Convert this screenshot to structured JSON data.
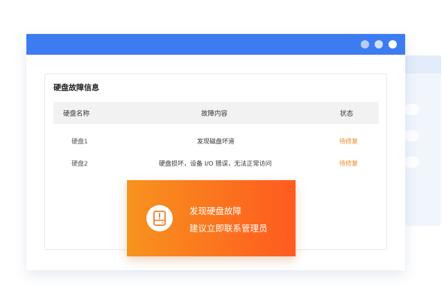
{
  "panel": {
    "title": "硬盘故障信息",
    "columns": [
      "硬盘名称",
      "故障内容",
      "状态"
    ],
    "rows": [
      {
        "name": "硬盘1",
        "content": "发现磁盘坏道",
        "status": "待修复"
      },
      {
        "name": "硬盘2",
        "content": "硬盘损坏，设备 I/O 错误，无法正常访问",
        "status": "待修复"
      }
    ]
  },
  "alert": {
    "line1": "发现硬盘故障",
    "line2": "建议立即联系管理员",
    "icon": "hard-disk-warning-icon"
  },
  "colors": {
    "titlebar": "#3d7bf0",
    "status": "#f08a24",
    "alert_start": "#f7931e",
    "alert_end": "#ff5a1f"
  }
}
